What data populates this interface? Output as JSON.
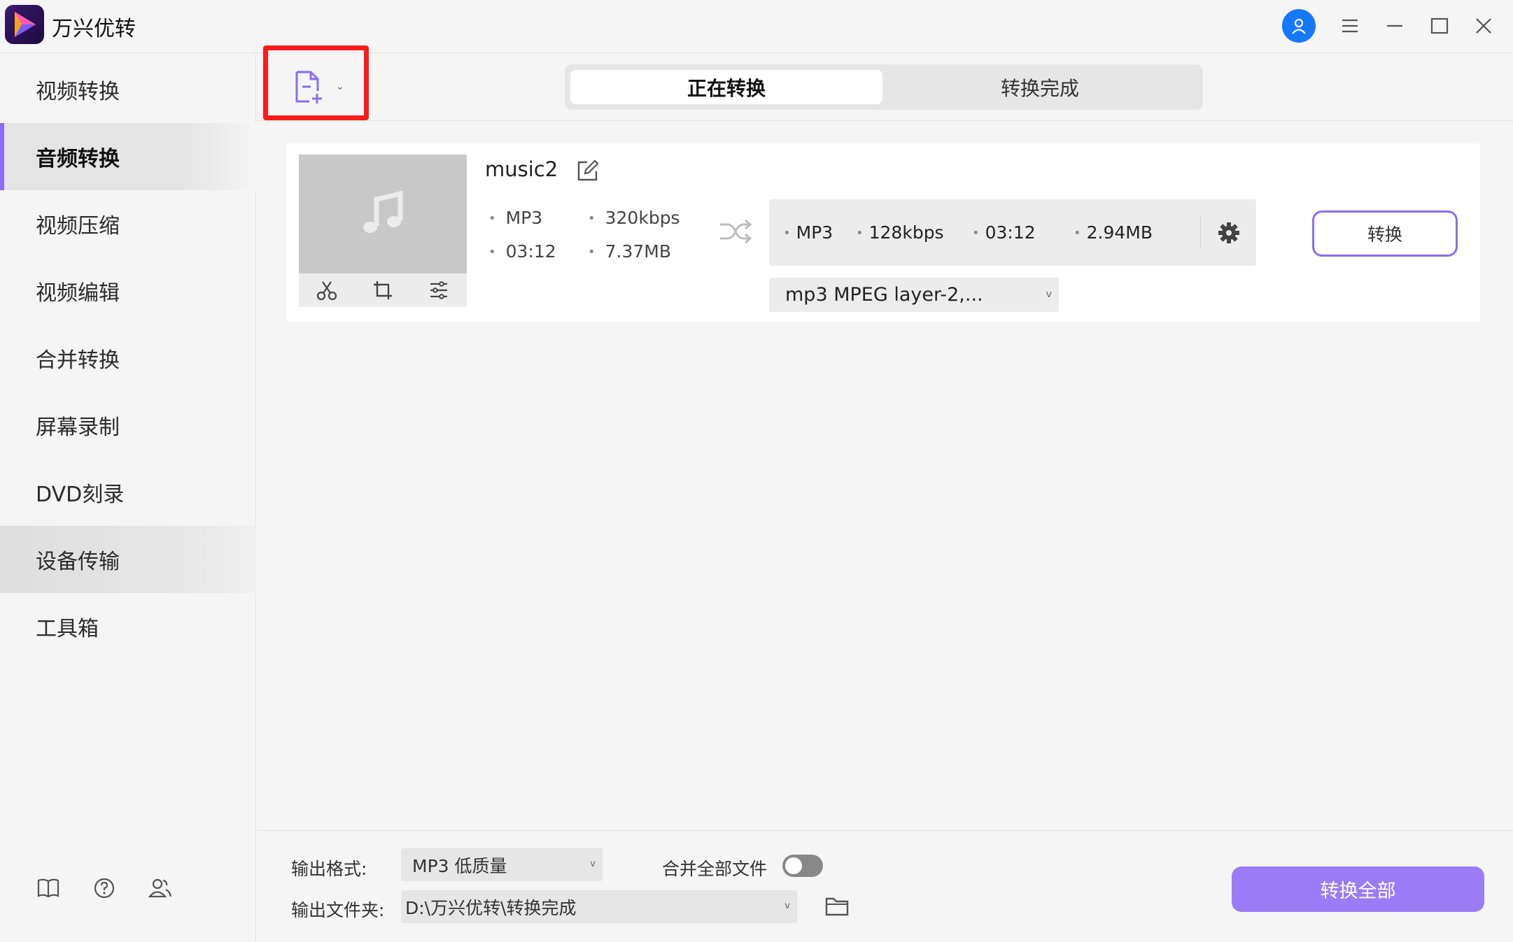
{
  "app": {
    "title": "万兴优转"
  },
  "sidebar": {
    "items": [
      {
        "label": "视频转换"
      },
      {
        "label": "音频转换"
      },
      {
        "label": "视频压缩"
      },
      {
        "label": "视频编辑"
      },
      {
        "label": "合并转换"
      },
      {
        "label": "屏幕录制"
      },
      {
        "label": "DVD刻录"
      },
      {
        "label": "设备传输"
      },
      {
        "label": "工具箱"
      }
    ],
    "active": "音频转换"
  },
  "tabs": {
    "converting": "正在转换",
    "completed": "转换完成"
  },
  "file": {
    "name": "music2",
    "source": {
      "format": "MP3",
      "bitrate": "320kbps",
      "duration": "03:12",
      "size": "7.37MB"
    },
    "output": {
      "format": "MP3",
      "bitrate": "128kbps",
      "duration": "03:12",
      "size": "2.94MB"
    },
    "codec": "mp3 MPEG layer-2,...",
    "convert_label": "转换"
  },
  "footer": {
    "format_label": "输出格式:",
    "format_value": "MP3 低质量",
    "merge_label": "合并全部文件",
    "merge_enabled": false,
    "folder_label": "输出文件夹:",
    "folder_value": "D:\\万兴优转\\转换完成",
    "convert_all_label": "转换全部"
  },
  "colors": {
    "accent": "#8b6cf6",
    "highlight": "#ff1a1a",
    "avatar": "#1677ff"
  }
}
